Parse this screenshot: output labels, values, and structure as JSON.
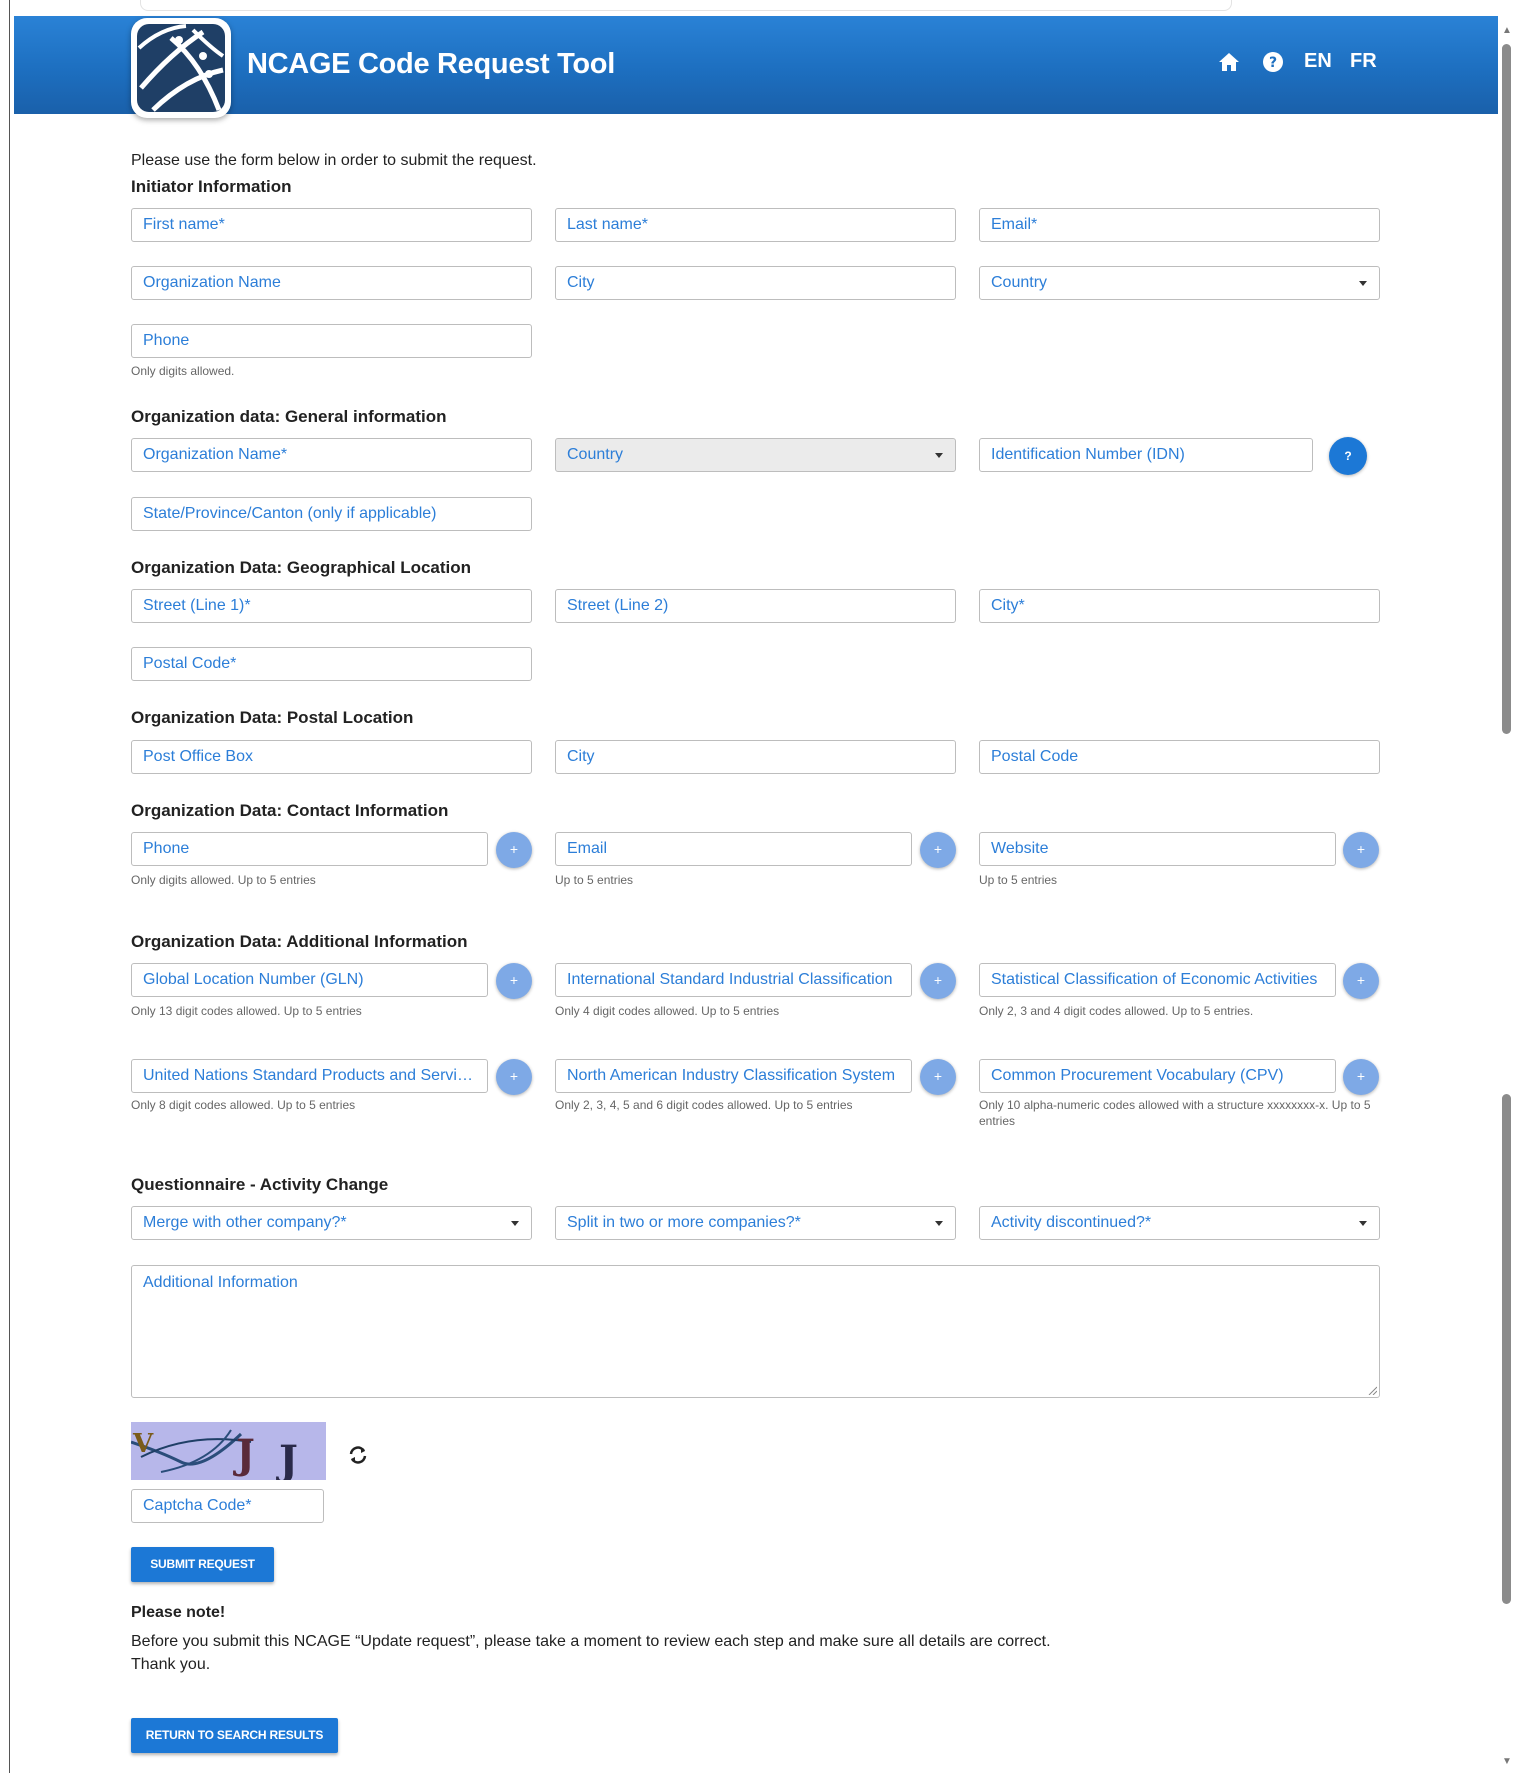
{
  "header": {
    "title": "NCAGE Code Request Tool",
    "lang_en": "EN",
    "lang_fr": "FR"
  },
  "intro": "Please use the form below in order to submit the request.",
  "initiator": {
    "heading": "Initiator Information",
    "first_name": "First name*",
    "last_name": "Last name*",
    "email": "Email*",
    "org_name": "Organization Name",
    "city": "City",
    "country": "Country",
    "phone": "Phone",
    "phone_hint": "Only digits allowed."
  },
  "general": {
    "heading": "Organization data: General information",
    "org_name": "Organization Name*",
    "country": "Country",
    "idn": "Identification Number (IDN)",
    "help": "?",
    "state": "State/Province/Canton (only if applicable)"
  },
  "geo": {
    "heading": "Organization Data: Geographical Location",
    "street1": "Street (Line 1)*",
    "street2": "Street (Line 2)",
    "city": "City*",
    "postal": "Postal Code*"
  },
  "postal": {
    "heading": "Organization Data: Postal Location",
    "pobox": "Post Office Box",
    "city": "City",
    "postal": "Postal Code"
  },
  "contact": {
    "heading": "Organization Data: Contact Information",
    "phone": "Phone",
    "phone_hint": "Only digits allowed. Up to 5 entries",
    "email": "Email",
    "email_hint": "Up to 5 entries",
    "website": "Website",
    "website_hint": "Up to 5 entries",
    "add": "+"
  },
  "additional": {
    "heading": "Organization Data: Additional Information",
    "gln": "Global Location Number (GLN)",
    "gln_hint": "Only 13 digit codes allowed. Up to 5 entries",
    "isic": "International Standard Industrial Classification",
    "isic_hint": "Only 4 digit codes allowed. Up to 5 entries",
    "nace": "Statistical Classification of Economic Activities",
    "nace_hint": "Only 2, 3 and 4 digit codes allowed. Up to 5 entries.",
    "unspsc": "United Nations Standard Products and Services Code",
    "unspsc_hint": "Only 8 digit codes allowed. Up to 5 entries",
    "naics": "North American Industry Classification System",
    "naics_hint": "Only 2, 3, 4, 5 and 6 digit codes allowed. Up to 5 entries",
    "cpv": "Common Procurement Vocabulary (CPV)",
    "cpv_hint": "Only 10 alpha-numeric codes allowed with a structure xxxxxxxx-x. Up to 5 entries",
    "add": "+"
  },
  "questionnaire": {
    "heading": "Questionnaire - Activity Change",
    "merge": "Merge with other company?*",
    "split": "Split in two or more companies?*",
    "discontinued": "Activity discontinued?*",
    "additional_info": "Additional Information"
  },
  "captcha": {
    "text": "VJJ",
    "field": "Captcha Code*"
  },
  "buttons": {
    "submit": "SUBMIT REQUEST",
    "return": "RETURN TO SEARCH RESULTS"
  },
  "note": {
    "title": "Please note!",
    "line1": "Before you submit this NCAGE “Update request”, please take a moment to review each step and make sure all details are correct.",
    "line2": "Thank you."
  },
  "colors": {
    "header_blue": "#1d6fc0",
    "accent_blue": "#1c78d6",
    "placeholder_blue": "#2c7ed8",
    "plus_blue": "#7ea9e6"
  }
}
